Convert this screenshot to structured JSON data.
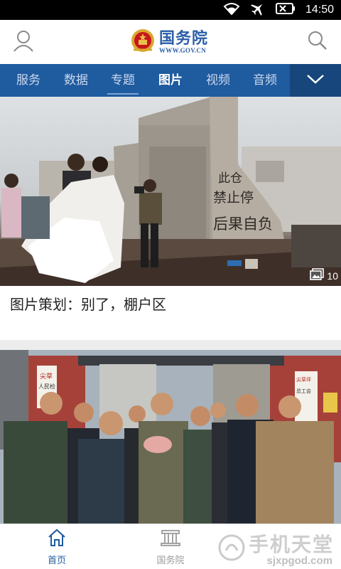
{
  "status_bar": {
    "time": "14:50",
    "icons": [
      "wifi-icon",
      "airplane-icon",
      "battery-icon"
    ]
  },
  "header": {
    "logo_name": "国务院",
    "logo_url": "WWW.GOV.CN",
    "left_icon": "user-icon",
    "right_icon": "search-icon"
  },
  "nav": {
    "tabs": [
      {
        "label": "服务"
      },
      {
        "label": "数据"
      },
      {
        "label": "专题"
      },
      {
        "label": "图片"
      },
      {
        "label": "视频"
      },
      {
        "label": "音频"
      }
    ],
    "active_tab": "图片",
    "more_icon": "chevron-down-icon"
  },
  "cards": [
    {
      "caption": "图片策划：别了，棚户区",
      "photo_count": "10",
      "sign_text": [
        "此仓",
        "禁止停",
        "后果自负"
      ]
    },
    {
      "caption": "",
      "sign_text": [
        "尖草",
        "人民检",
        "尖草坪",
        "总工会"
      ]
    }
  ],
  "bottom_nav": {
    "items": [
      {
        "label": "首页",
        "icon": "home-icon",
        "active": true
      },
      {
        "label": "国务院",
        "icon": "building-icon",
        "active": false
      }
    ],
    "active_color": "#1f5b9f",
    "inactive_color": "#9a9a9a"
  },
  "watermark": {
    "text": "手机天堂",
    "url": "sjxpgod.com"
  },
  "colors": {
    "brand_blue": "#1f5b9f",
    "nav_more": "#17467d"
  }
}
